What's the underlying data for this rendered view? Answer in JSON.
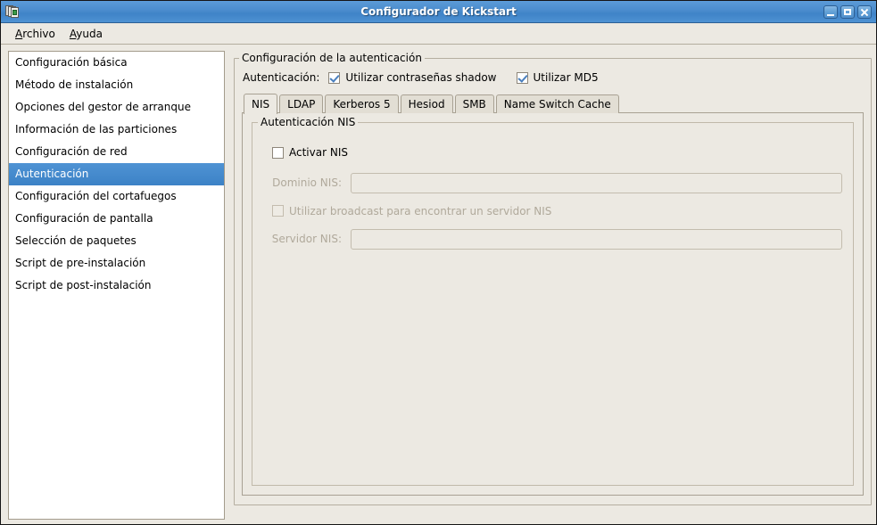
{
  "window": {
    "title": "Configurador de Kickstart",
    "icon": "kickstart-app-icon",
    "controls": {
      "minimize": "minimize-button",
      "maximize": "maximize-button",
      "close": "close-button"
    }
  },
  "menubar": {
    "items": [
      {
        "label": "Archivo",
        "mnemonic": "A",
        "rest": "rchivo"
      },
      {
        "label": "Ayuda",
        "mnemonic": "A",
        "rest": "yuda"
      }
    ]
  },
  "sidebar": {
    "items": [
      {
        "label": "Configuración básica",
        "selected": false
      },
      {
        "label": "Método de instalación",
        "selected": false
      },
      {
        "label": "Opciones del gestor de arranque",
        "selected": false
      },
      {
        "label": "Información de las particiones",
        "selected": false
      },
      {
        "label": "Configuración de red",
        "selected": false
      },
      {
        "label": "Autenticación",
        "selected": true
      },
      {
        "label": "Configuración del cortafuegos",
        "selected": false
      },
      {
        "label": "Configuración de pantalla",
        "selected": false
      },
      {
        "label": "Selección de paquetes",
        "selected": false
      },
      {
        "label": "Script de pre-instalación",
        "selected": false
      },
      {
        "label": "Script de post-instalación",
        "selected": false
      }
    ]
  },
  "main": {
    "frame_legend": "Configuración de la autenticación",
    "auth_label": "Autenticación:",
    "options": [
      {
        "label": "Utilizar contraseñas shadow",
        "checked": true,
        "enabled": true
      },
      {
        "label": "Utilizar MD5",
        "checked": true,
        "enabled": true
      }
    ],
    "tabs": [
      {
        "label": "NIS",
        "active": true
      },
      {
        "label": "LDAP",
        "active": false
      },
      {
        "label": "Kerberos 5",
        "active": false
      },
      {
        "label": "Hesiod",
        "active": false
      },
      {
        "label": "SMB",
        "active": false
      },
      {
        "label": "Name Switch Cache",
        "active": false
      }
    ],
    "nis_panel": {
      "legend": "Autenticación NIS",
      "enable_checkbox": {
        "label": "Activar NIS",
        "checked": false,
        "enabled": true
      },
      "domain_label": "Dominio NIS:",
      "domain_value": "",
      "domain_enabled": false,
      "broadcast_checkbox": {
        "label": "Utilizar broadcast para encontrar un servidor NIS",
        "checked": false,
        "enabled": false
      },
      "server_label": "Servidor NIS:",
      "server_value": "",
      "server_enabled": false
    }
  },
  "colors": {
    "titlebar_blue": "#4a8ccd",
    "selection_blue": "#3c82c6",
    "background": "#ece9e2",
    "border": "#a8a193",
    "check_blue": "#4a7fbd",
    "disabled_text": "#b0a99b"
  }
}
